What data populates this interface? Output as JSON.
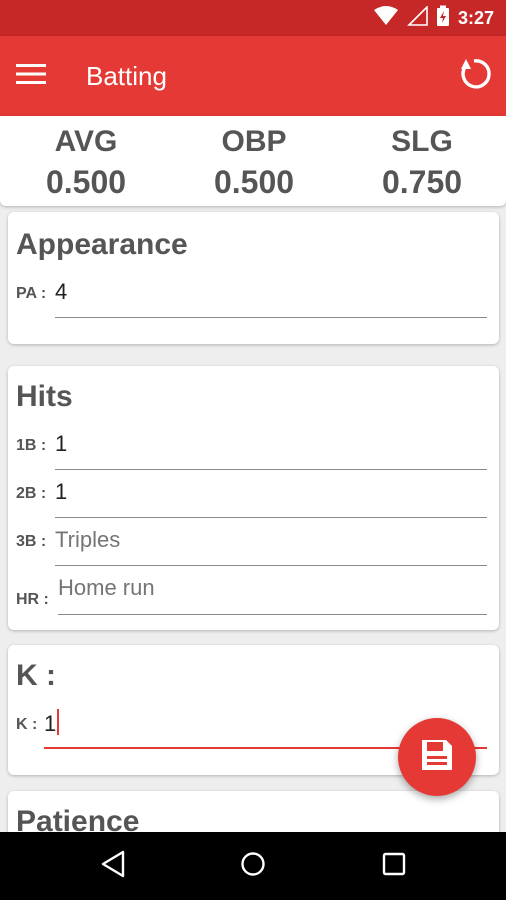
{
  "status_bar": {
    "time": "3:27"
  },
  "app_bar": {
    "title": "Batting"
  },
  "summary": {
    "avg_label": "AVG",
    "avg_value": "0.500",
    "obp_label": "OBP",
    "obp_value": "0.500",
    "slg_label": "SLG",
    "slg_value": "0.750"
  },
  "appearance": {
    "title": "Appearance",
    "pa_label": "PA :",
    "pa_value": "4"
  },
  "hits": {
    "title": "Hits",
    "singles_label": "1B :",
    "singles_value": "1",
    "doubles_label": "2B :",
    "doubles_value": "1",
    "triples_label": "3B :",
    "triples_placeholder": "Triples",
    "hr_label": "HR :",
    "hr_placeholder": "Home run"
  },
  "strikeouts": {
    "title": "K :",
    "k_label": "K :",
    "k_value": "1"
  },
  "patience": {
    "title": "Patience"
  },
  "colors": {
    "primary": "#e53935",
    "primary_dark": "#c62828"
  },
  "icons": {
    "menu": "menu-icon",
    "refresh": "refresh-icon",
    "save": "save-icon",
    "wifi": "wifi-icon",
    "signal": "signal-icon",
    "battery": "battery-icon",
    "back": "back-icon",
    "home": "home-icon",
    "recents": "recents-icon"
  }
}
